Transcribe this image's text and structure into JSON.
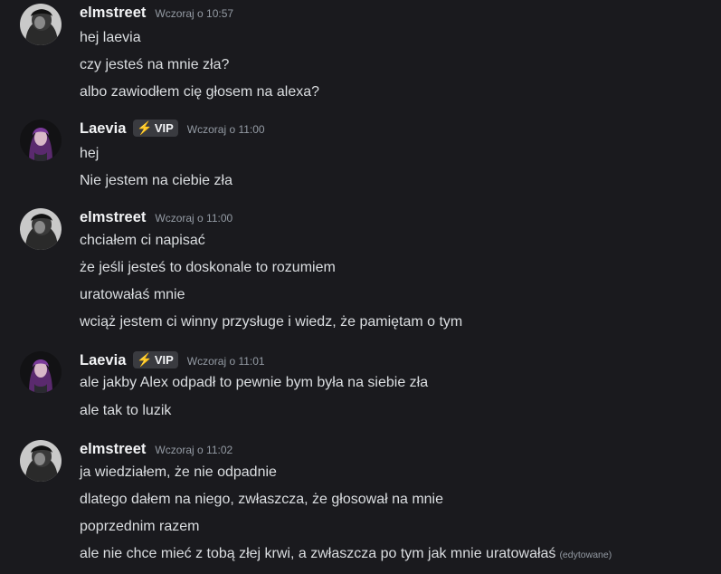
{
  "messages": [
    {
      "author": "elmstreet",
      "timestamp": "Wczoraj o 10:57",
      "lines": [
        "hej laevia",
        "czy jesteś na mnie zła?",
        "albo zawiodłem cię głosem na alexa?"
      ]
    },
    {
      "author": "Laevia",
      "badge": "VIP",
      "badge_icon": "⚡",
      "timestamp": "Wczoraj o 11:00",
      "lines": [
        "hej",
        "Nie jestem na ciebie zła"
      ]
    },
    {
      "author": "elmstreet",
      "timestamp": "Wczoraj o 11:00",
      "lines": [
        "chciałem ci napisać",
        "że jeśli jesteś to doskonale to rozumiem",
        "uratowałaś mnie",
        "wciąż jestem ci winny przysługe i wiedz, że pamiętam o tym"
      ]
    },
    {
      "author": "Laevia",
      "badge": "VIP",
      "badge_icon": "⚡",
      "timestamp": "Wczoraj o 11:01",
      "lines": [
        "ale jakby Alex odpadł to pewnie bym była na siebie zła",
        "ale tak to luzik"
      ]
    },
    {
      "author": "elmstreet",
      "timestamp": "Wczoraj o 11:02",
      "lines": [
        "ja wiedziałem, że nie odpadnie",
        "dlatego dałem na niego, zwłaszcza, że głosował na mnie",
        "poprzednim razem",
        "ale nie chce mieć z tobą złej krwi, a zwłaszcza po tym jak mnie uratowałaś"
      ],
      "edited_label": "(edytowane)"
    }
  ],
  "colors": {
    "background": "#1a1a1e",
    "username": "#f2f3f5",
    "timestamp": "#949ba4",
    "text": "#dbdee1",
    "badge_bg": "#3a3b40",
    "badge_bolt": "#f5c518"
  }
}
